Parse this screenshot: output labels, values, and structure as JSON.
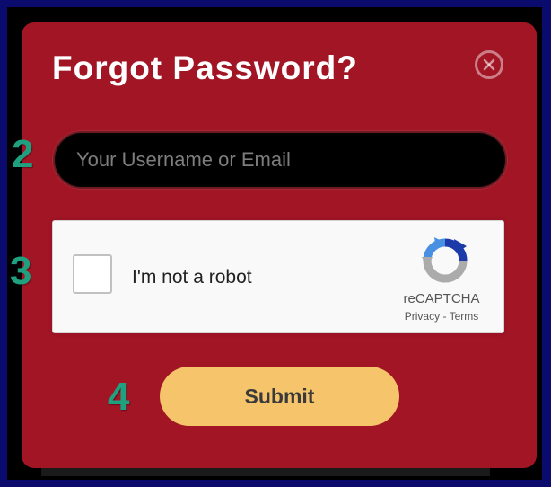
{
  "modal": {
    "title": "Forgot Password?",
    "close_icon": "close-circle-icon"
  },
  "steps": {
    "input_step": "2",
    "captcha_step": "3",
    "submit_step": "4",
    "color": "#1fa07f"
  },
  "form": {
    "email_value": "",
    "email_placeholder": "Your Username or Email",
    "submit_label": "Submit"
  },
  "recaptcha": {
    "checkbox_label": "I'm not a robot",
    "brand": "reCAPTCHA",
    "privacy_link": "Privacy",
    "separator": " - ",
    "terms_link": "Terms",
    "logo_icon": "recaptcha-logo-icon"
  },
  "colors": {
    "modal_background": "#a11525",
    "submit_background": "#f5c46b",
    "page_border": "#0b0b6e"
  }
}
